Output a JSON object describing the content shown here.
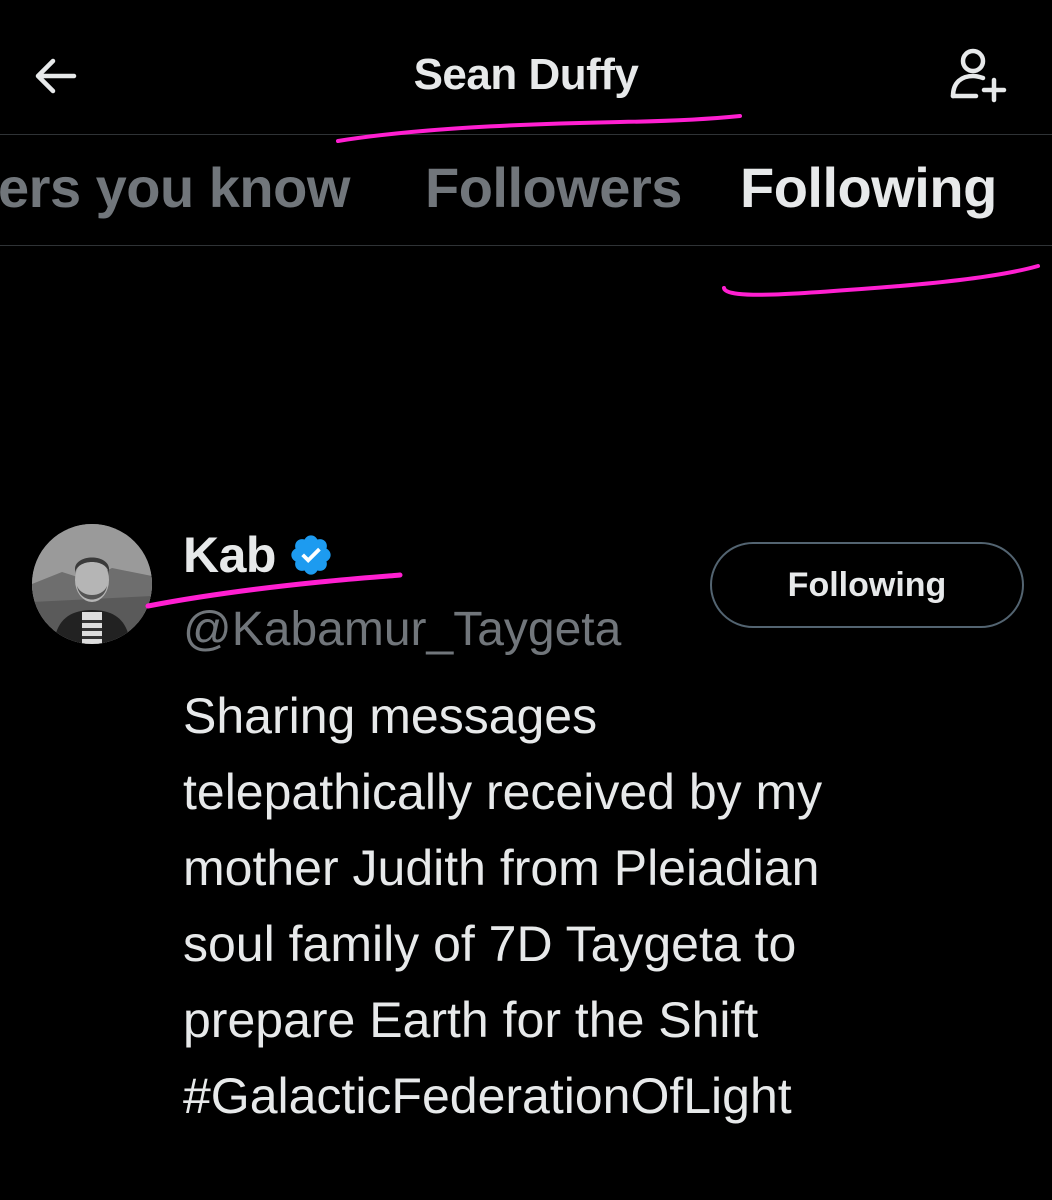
{
  "header": {
    "title": "Sean Duffy",
    "back_icon": "arrow-left-icon",
    "add_user_icon": "person-add-icon"
  },
  "tabs": [
    {
      "label": "Followers you know",
      "visible_text": "ers you know",
      "active": false
    },
    {
      "label": "Followers",
      "active": false
    },
    {
      "label": "Following",
      "active": true
    }
  ],
  "user": {
    "display_name": "Kab",
    "verified": true,
    "handle": "@Kabamur_Taygeta",
    "follow_button_label": "Following",
    "bio": "Sharing messages\ntelepathically received by my\nmother Judith from Pleiadian\nsoul family of 7D Taygeta to\nprepare Earth for the Shift\n#GalacticFederationOfLight"
  },
  "colors": {
    "background": "#000000",
    "primary_text": "#e7e9ea",
    "secondary_text": "#71767b",
    "divider": "#2f3336",
    "verified_blue": "#1d9bf0",
    "annotation_magenta": "#ff1fd1"
  }
}
